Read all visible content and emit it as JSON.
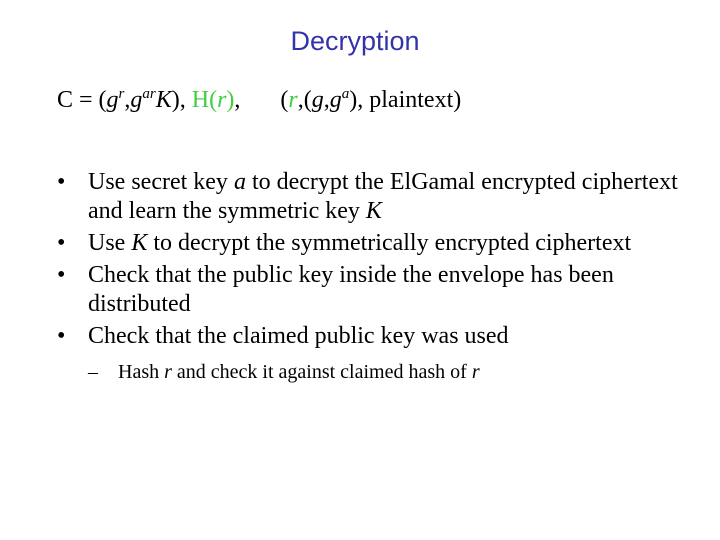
{
  "slide": {
    "title": "Decryption",
    "colors": {
      "title": "#3333aa",
      "highlight": "#44cc44",
      "text": "#000000",
      "background": "#ffffff"
    },
    "formula": {
      "c_label": "C = (",
      "g1": "g",
      "sup_r": "r",
      "comma1": ",",
      "g2": "g",
      "sup_ar": "ar",
      "K": "K",
      "close1": "), ",
      "hash_H": "H(",
      "hash_r": "r",
      "hash_close": ")",
      "comma2": ",",
      "open2": "(",
      "env_r": "r",
      "env_mid": ",(",
      "env_g1": "g",
      "env_comma": ",",
      "env_g2": "g",
      "env_sup_a": "a",
      "env_close": "), plaintext)"
    },
    "bullets": [
      {
        "bullet": "•",
        "pre": "Use secret key ",
        "em": "a",
        "mid": " to decrypt the ElGamal encrypted ciphertext and learn the symmetric key ",
        "em2": "K"
      },
      {
        "bullet": "•",
        "pre": "Use ",
        "em": "K",
        "mid": " to decrypt the symmetrically encrypted ciphertext"
      },
      {
        "bullet": "•",
        "text": "Check that the public key inside the envelope has been distributed"
      },
      {
        "bullet": "•",
        "text": "Check that the claimed public key was used",
        "sub": [
          {
            "dash": "–",
            "pre": "Hash ",
            "em": "r",
            "mid": " and check it against claimed hash of ",
            "em2": "r"
          }
        ]
      }
    ]
  }
}
